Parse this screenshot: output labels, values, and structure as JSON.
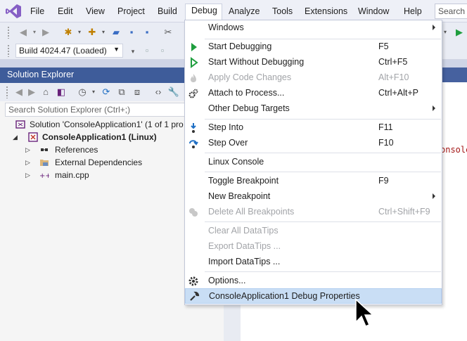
{
  "menubar": {
    "items": [
      "File",
      "Edit",
      "View",
      "Project",
      "Build",
      "Debug",
      "Analyze",
      "Tools",
      "Extensions",
      "Window",
      "Help"
    ],
    "search_placeholder": "Search ("
  },
  "toolbar": {
    "configuration": "Build 4024.47 (Loaded)"
  },
  "solution_explorer": {
    "title": "Solution Explorer",
    "search_placeholder": "Search Solution Explorer (Ctrl+;)",
    "tree": [
      "Solution 'ConsoleApplication1' (1 of 1 pro",
      "ConsoleApplication1 (Linux)",
      "References",
      "External Dependencies",
      "main.cpp"
    ]
  },
  "editor": {
    "fragment": "onsole"
  },
  "debug_menu": {
    "items": [
      {
        "label": "Windows",
        "shortcut": "",
        "submenu": true,
        "enabled": true
      },
      {
        "label": "Start Debugging",
        "shortcut": "F5",
        "enabled": true,
        "icon": "play-icon"
      },
      {
        "label": "Start Without Debugging",
        "shortcut": "Ctrl+F5",
        "enabled": true,
        "icon": "play-outline-icon"
      },
      {
        "label": "Apply Code Changes",
        "shortcut": "Alt+F10",
        "enabled": false,
        "icon": "flame-icon"
      },
      {
        "label": "Attach to Process...",
        "shortcut": "Ctrl+Alt+P",
        "enabled": true,
        "icon": "gears-icon"
      },
      {
        "label": "Other Debug Targets",
        "shortcut": "",
        "submenu": true,
        "enabled": true
      },
      {
        "label": "Step Into",
        "shortcut": "F11",
        "enabled": true,
        "icon": "step-into-icon"
      },
      {
        "label": "Step Over",
        "shortcut": "F10",
        "enabled": true,
        "icon": "step-over-icon"
      },
      {
        "label": "Linux Console",
        "shortcut": "",
        "enabled": true
      },
      {
        "label": "Toggle Breakpoint",
        "shortcut": "F9",
        "enabled": true
      },
      {
        "label": "New Breakpoint",
        "shortcut": "",
        "submenu": true,
        "enabled": true
      },
      {
        "label": "Delete All Breakpoints",
        "shortcut": "Ctrl+Shift+F9",
        "enabled": false,
        "icon": "delete-breakpoints-icon"
      },
      {
        "label": "Clear All DataTips",
        "shortcut": "",
        "enabled": false
      },
      {
        "label": "Export DataTips ...",
        "shortcut": "",
        "enabled": false
      },
      {
        "label": "Import DataTips ...",
        "shortcut": "",
        "enabled": true
      },
      {
        "label": "Options...",
        "shortcut": "",
        "enabled": true,
        "icon": "gear-icon"
      },
      {
        "label": "ConsoleApplication1 Debug Properties",
        "shortcut": "",
        "enabled": true,
        "highlighted": true,
        "icon": "wrench-icon"
      }
    ]
  },
  "colors": {
    "accent": "#3e5c9a",
    "highlight": "#c9def5",
    "play_green": "#1f9e3e",
    "disabled_text": "#a2a4a8",
    "vs_purple": "#68217a"
  }
}
